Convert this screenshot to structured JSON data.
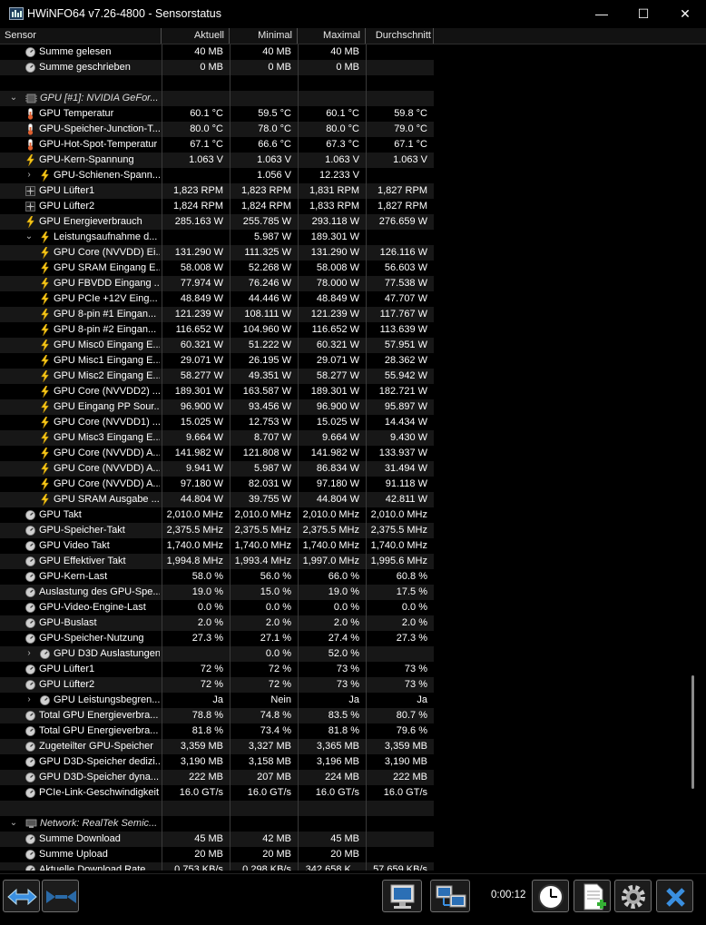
{
  "window": {
    "title": "HWiNFO64 v7.26-4800 - Sensorstatus",
    "minimize": "—",
    "maximize": "☐",
    "close": "✕"
  },
  "columns": {
    "sensor": "Sensor",
    "current": "Aktuell",
    "min": "Minimal",
    "max": "Maximal",
    "avg": "Durchschnitt"
  },
  "rows": [
    {
      "type": "item",
      "indent": 1,
      "icon": "gauge-icon",
      "name": "Summe gelesen",
      "v": [
        "40 MB",
        "40 MB",
        "40 MB",
        ""
      ]
    },
    {
      "type": "item",
      "indent": 1,
      "icon": "gauge-icon",
      "name": "Summe geschrieben",
      "v": [
        "0 MB",
        "0 MB",
        "0 MB",
        ""
      ]
    },
    {
      "type": "blank"
    },
    {
      "type": "group",
      "name": "GPU [#1]: NVIDIA GeFor...",
      "icon": "chip-icon"
    },
    {
      "type": "item",
      "indent": 1,
      "icon": "thermometer-icon",
      "name": "GPU Temperatur",
      "v": [
        "60.1 °C",
        "59.5 °C",
        "60.1 °C",
        "59.8 °C"
      ]
    },
    {
      "type": "item",
      "indent": 1,
      "icon": "thermometer-icon",
      "name": "GPU-Speicher-Junction-T...",
      "v": [
        "80.0 °C",
        "78.0 °C",
        "80.0 °C",
        "79.0 °C"
      ]
    },
    {
      "type": "item",
      "indent": 1,
      "icon": "thermometer-icon",
      "name": "GPU-Hot-Spot-Temperatur",
      "v": [
        "67.1 °C",
        "66.6 °C",
        "67.3 °C",
        "67.1 °C"
      ]
    },
    {
      "type": "item",
      "indent": 1,
      "icon": "lightning-icon",
      "name": "GPU-Kern-Spannung",
      "v": [
        "1.063 V",
        "1.063 V",
        "1.063 V",
        "1.063 V"
      ]
    },
    {
      "type": "item",
      "indent": 2,
      "icon": "lightning-icon",
      "name": "GPU-Schienen-Spann...",
      "v": [
        "",
        "1.056 V",
        "12.233 V",
        ""
      ],
      "toggle": "›"
    },
    {
      "type": "item",
      "indent": 1,
      "icon": "fan-icon",
      "name": "GPU Lüfter1",
      "v": [
        "1,823 RPM",
        "1,823 RPM",
        "1,831 RPM",
        "1,827 RPM"
      ]
    },
    {
      "type": "item",
      "indent": 1,
      "icon": "fan-icon",
      "name": "GPU Lüfter2",
      "v": [
        "1,824 RPM",
        "1,824 RPM",
        "1,833 RPM",
        "1,827 RPM"
      ]
    },
    {
      "type": "item",
      "indent": 1,
      "icon": "lightning-icon",
      "name": "GPU Energieverbrauch",
      "v": [
        "285.163 W",
        "255.785 W",
        "293.118 W",
        "276.659 W"
      ]
    },
    {
      "type": "item",
      "indent": 2,
      "icon": "lightning-icon",
      "name": "Leistungsaufnahme d...",
      "v": [
        "",
        "5.987 W",
        "189.301 W",
        ""
      ],
      "toggle": "⌄"
    },
    {
      "type": "item",
      "indent": 2,
      "icon": "lightning-icon",
      "name": "GPU Core (NVVDD) Ei...",
      "v": [
        "131.290 W",
        "111.325 W",
        "131.290 W",
        "126.116 W"
      ]
    },
    {
      "type": "item",
      "indent": 2,
      "icon": "lightning-icon",
      "name": "GPU SRAM Eingang E...",
      "v": [
        "58.008 W",
        "52.268 W",
        "58.008 W",
        "56.603 W"
      ]
    },
    {
      "type": "item",
      "indent": 2,
      "icon": "lightning-icon",
      "name": "GPU FBVDD Eingang ...",
      "v": [
        "77.974 W",
        "76.246 W",
        "78.000 W",
        "77.538 W"
      ]
    },
    {
      "type": "item",
      "indent": 2,
      "icon": "lightning-icon",
      "name": "GPU PCIe +12V Eing...",
      "v": [
        "48.849 W",
        "44.446 W",
        "48.849 W",
        "47.707 W"
      ]
    },
    {
      "type": "item",
      "indent": 2,
      "icon": "lightning-icon",
      "name": "GPU 8-pin #1 Eingan...",
      "v": [
        "121.239 W",
        "108.111 W",
        "121.239 W",
        "117.767 W"
      ]
    },
    {
      "type": "item",
      "indent": 2,
      "icon": "lightning-icon",
      "name": "GPU 8-pin #2 Eingan...",
      "v": [
        "116.652 W",
        "104.960 W",
        "116.652 W",
        "113.639 W"
      ]
    },
    {
      "type": "item",
      "indent": 2,
      "icon": "lightning-icon",
      "name": "GPU Misc0 Eingang E...",
      "v": [
        "60.321 W",
        "51.222 W",
        "60.321 W",
        "57.951 W"
      ]
    },
    {
      "type": "item",
      "indent": 2,
      "icon": "lightning-icon",
      "name": "GPU Misc1 Eingang E...",
      "v": [
        "29.071 W",
        "26.195 W",
        "29.071 W",
        "28.362 W"
      ]
    },
    {
      "type": "item",
      "indent": 2,
      "icon": "lightning-icon",
      "name": "GPU Misc2 Eingang E...",
      "v": [
        "58.277 W",
        "49.351 W",
        "58.277 W",
        "55.942 W"
      ]
    },
    {
      "type": "item",
      "indent": 2,
      "icon": "lightning-icon",
      "name": "GPU Core (NVVDD2) ...",
      "v": [
        "189.301 W",
        "163.587 W",
        "189.301 W",
        "182.721 W"
      ]
    },
    {
      "type": "item",
      "indent": 2,
      "icon": "lightning-icon",
      "name": "GPU Eingang PP Sour...",
      "v": [
        "96.900 W",
        "93.456 W",
        "96.900 W",
        "95.897 W"
      ]
    },
    {
      "type": "item",
      "indent": 2,
      "icon": "lightning-icon",
      "name": "GPU Core (NVVDD1) ...",
      "v": [
        "15.025 W",
        "12.753 W",
        "15.025 W",
        "14.434 W"
      ]
    },
    {
      "type": "item",
      "indent": 2,
      "icon": "lightning-icon",
      "name": "GPU Misc3 Eingang E...",
      "v": [
        "9.664 W",
        "8.707 W",
        "9.664 W",
        "9.430 W"
      ]
    },
    {
      "type": "item",
      "indent": 2,
      "icon": "lightning-icon",
      "name": "GPU Core (NVVDD) A...",
      "v": [
        "141.982 W",
        "121.808 W",
        "141.982 W",
        "133.937 W"
      ]
    },
    {
      "type": "item",
      "indent": 2,
      "icon": "lightning-icon",
      "name": "GPU Core (NVVDD) A...",
      "v": [
        "9.941 W",
        "5.987 W",
        "86.834 W",
        "31.494 W"
      ]
    },
    {
      "type": "item",
      "indent": 2,
      "icon": "lightning-icon",
      "name": "GPU Core (NVVDD) A...",
      "v": [
        "97.180 W",
        "82.031 W",
        "97.180 W",
        "91.118 W"
      ]
    },
    {
      "type": "item",
      "indent": 2,
      "icon": "lightning-icon",
      "name": "GPU SRAM Ausgabe ...",
      "v": [
        "44.804 W",
        "39.755 W",
        "44.804 W",
        "42.811 W"
      ]
    },
    {
      "type": "item",
      "indent": 1,
      "icon": "gauge-icon",
      "name": "GPU Takt",
      "v": [
        "2,010.0 MHz",
        "2,010.0 MHz",
        "2,010.0 MHz",
        "2,010.0 MHz"
      ]
    },
    {
      "type": "item",
      "indent": 1,
      "icon": "gauge-icon",
      "name": "GPU-Speicher-Takt",
      "v": [
        "2,375.5 MHz",
        "2,375.5 MHz",
        "2,375.5 MHz",
        "2,375.5 MHz"
      ]
    },
    {
      "type": "item",
      "indent": 1,
      "icon": "gauge-icon",
      "name": "GPU Video Takt",
      "v": [
        "1,740.0 MHz",
        "1,740.0 MHz",
        "1,740.0 MHz",
        "1,740.0 MHz"
      ]
    },
    {
      "type": "item",
      "indent": 1,
      "icon": "gauge-icon",
      "name": "GPU Effektiver Takt",
      "v": [
        "1,994.8 MHz",
        "1,993.4 MHz",
        "1,997.0 MHz",
        "1,995.6 MHz"
      ]
    },
    {
      "type": "item",
      "indent": 1,
      "icon": "gauge-icon",
      "name": "GPU-Kern-Last",
      "v": [
        "58.0 %",
        "56.0 %",
        "66.0 %",
        "60.8 %"
      ]
    },
    {
      "type": "item",
      "indent": 1,
      "icon": "gauge-icon",
      "name": "Auslastung des GPU-Spe...",
      "v": [
        "19.0 %",
        "15.0 %",
        "19.0 %",
        "17.5 %"
      ]
    },
    {
      "type": "item",
      "indent": 1,
      "icon": "gauge-icon",
      "name": "GPU-Video-Engine-Last",
      "v": [
        "0.0 %",
        "0.0 %",
        "0.0 %",
        "0.0 %"
      ]
    },
    {
      "type": "item",
      "indent": 1,
      "icon": "gauge-icon",
      "name": "GPU-Buslast",
      "v": [
        "2.0 %",
        "2.0 %",
        "2.0 %",
        "2.0 %"
      ]
    },
    {
      "type": "item",
      "indent": 1,
      "icon": "gauge-icon",
      "name": "GPU-Speicher-Nutzung",
      "v": [
        "27.3 %",
        "27.1 %",
        "27.4 %",
        "27.3 %"
      ]
    },
    {
      "type": "item",
      "indent": 2,
      "icon": "gauge-icon",
      "name": "GPU D3D Auslastungen",
      "v": [
        "",
        "0.0 %",
        "52.0 %",
        ""
      ],
      "toggle": "›"
    },
    {
      "type": "item",
      "indent": 1,
      "icon": "gauge-icon",
      "name": "GPU Lüfter1",
      "v": [
        "72 %",
        "72 %",
        "73 %",
        "73 %"
      ]
    },
    {
      "type": "item",
      "indent": 1,
      "icon": "gauge-icon",
      "name": "GPU Lüfter2",
      "v": [
        "72 %",
        "72 %",
        "73 %",
        "73 %"
      ]
    },
    {
      "type": "item",
      "indent": 2,
      "icon": "gauge-icon",
      "name": "GPU Leistungsbegren...",
      "v": [
        "Ja",
        "Nein",
        "Ja",
        "Ja"
      ],
      "toggle": "›"
    },
    {
      "type": "item",
      "indent": 1,
      "icon": "gauge-icon",
      "name": "Total GPU Energieverbra...",
      "v": [
        "78.8 %",
        "74.8 %",
        "83.5 %",
        "80.7 %"
      ]
    },
    {
      "type": "item",
      "indent": 1,
      "icon": "gauge-icon",
      "name": "Total GPU Energieverbra...",
      "v": [
        "81.8 %",
        "73.4 %",
        "81.8 %",
        "79.6 %"
      ]
    },
    {
      "type": "item",
      "indent": 1,
      "icon": "gauge-icon",
      "name": "Zugeteilter GPU-Speicher",
      "v": [
        "3,359 MB",
        "3,327 MB",
        "3,365 MB",
        "3,359 MB"
      ]
    },
    {
      "type": "item",
      "indent": 1,
      "icon": "gauge-icon",
      "name": "GPU D3D-Speicher dedizi...",
      "v": [
        "3,190 MB",
        "3,158 MB",
        "3,196 MB",
        "3,190 MB"
      ]
    },
    {
      "type": "item",
      "indent": 1,
      "icon": "gauge-icon",
      "name": "GPU D3D-Speicher dyna...",
      "v": [
        "222 MB",
        "207 MB",
        "224 MB",
        "222 MB"
      ]
    },
    {
      "type": "item",
      "indent": 1,
      "icon": "gauge-icon",
      "name": "PCIe-Link-Geschwindigkeit",
      "v": [
        "16.0 GT/s",
        "16.0 GT/s",
        "16.0 GT/s",
        "16.0 GT/s"
      ]
    },
    {
      "type": "blank"
    },
    {
      "type": "group",
      "name": "Network: RealTek Semic...",
      "icon": "network-icon"
    },
    {
      "type": "item",
      "indent": 1,
      "icon": "gauge-icon",
      "name": "Summe Download",
      "v": [
        "45 MB",
        "42 MB",
        "45 MB",
        ""
      ]
    },
    {
      "type": "item",
      "indent": 1,
      "icon": "gauge-icon",
      "name": "Summe Upload",
      "v": [
        "20 MB",
        "20 MB",
        "20 MB",
        ""
      ]
    },
    {
      "type": "item",
      "indent": 1,
      "icon": "gauge-icon",
      "name": "Aktuelle Download Rate",
      "v": [
        "0.753 KB/s",
        "0.298 KB/s",
        "342.658 K...",
        "57.659 KB/s"
      ]
    }
  ],
  "toolbar": {
    "timer": "0:00:12"
  },
  "colors": {
    "bg": "#000000",
    "altrow": "#171717",
    "lightning": "#f5c518",
    "thermometer": "#e06030"
  }
}
